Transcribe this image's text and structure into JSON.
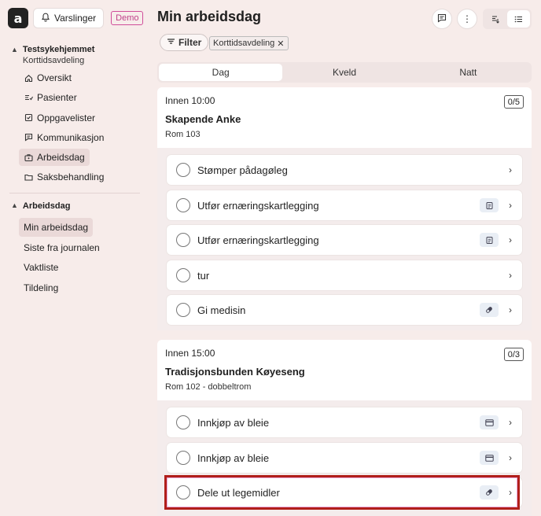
{
  "app": {
    "logo_letter": "a",
    "notifications_label": "Varslinger",
    "demo_badge": "Demo"
  },
  "sidebar": {
    "org_name": "Testsykehjemmet",
    "org_unit": "Korttidsavdeling",
    "items": [
      {
        "label": "Oversikt",
        "icon": "home-icon"
      },
      {
        "label": "Pasienter",
        "icon": "patients-icon"
      },
      {
        "label": "Oppgavelister",
        "icon": "checklist-icon"
      },
      {
        "label": "Kommunikasjon",
        "icon": "message-icon"
      },
      {
        "label": "Arbeidsdag",
        "icon": "briefcase-icon"
      },
      {
        "label": "Saksbehandling",
        "icon": "folder-icon"
      }
    ],
    "section2_title": "Arbeidsdag",
    "section2_items": [
      {
        "label": "Min arbeidsdag"
      },
      {
        "label": "Siste fra journalen"
      },
      {
        "label": "Vaktliste"
      },
      {
        "label": "Tildeling"
      }
    ]
  },
  "main": {
    "title": "Min arbeidsdag",
    "filter_label": "Filter",
    "chip_label": "Korttidsavdeling",
    "tabs": [
      "Dag",
      "Kveld",
      "Natt"
    ],
    "groups": [
      {
        "time": "Innen 10:00",
        "patient": "Skapende Anke",
        "room": "Rom 103",
        "count": "0/5",
        "tasks": [
          {
            "label": "Stømper pådagøleg",
            "tag": ""
          },
          {
            "label": "Utfør ernæringskartlegging",
            "tag": "clipboard-icon"
          },
          {
            "label": "Utfør ernæringskartlegging",
            "tag": "clipboard-icon"
          },
          {
            "label": "tur",
            "tag": ""
          },
          {
            "label": "Gi medisin",
            "tag": "pill-icon"
          }
        ]
      },
      {
        "time": "Innen 15:00",
        "patient": "Tradisjonsbunden Køyeseng",
        "room": "Rom 102 - dobbeltrom",
        "count": "0/3",
        "tasks": [
          {
            "label": "Innkjøp av bleie",
            "tag": "card-icon"
          },
          {
            "label": "Innkjøp av bleie",
            "tag": "card-icon"
          },
          {
            "label": "Dele ut legemidler",
            "tag": "pill-icon"
          }
        ]
      }
    ]
  },
  "colors": {
    "background": "#f7ecea",
    "highlight_border": "#b11f1a",
    "demo_accent": "#c0418a"
  }
}
